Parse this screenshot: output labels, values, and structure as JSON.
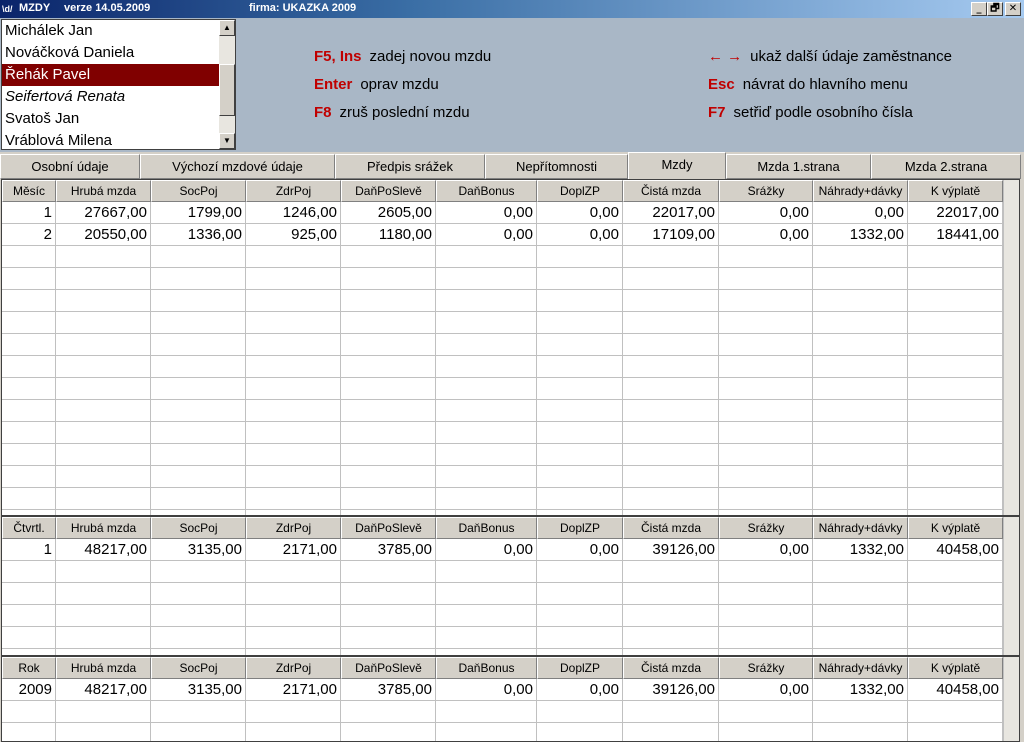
{
  "window": {
    "app_title": "MZDY",
    "version": "verze 14.05.2009",
    "firm": "firma: UKAZKA 2009",
    "icon_text": "\\d/",
    "min_glyph": "_",
    "max_glyph": "🗗",
    "close_glyph": "✕"
  },
  "employees": [
    {
      "name": "Michálek Jan",
      "selected": false,
      "italic": false
    },
    {
      "name": "Nováčková Daniela",
      "selected": false,
      "italic": false
    },
    {
      "name": "Řehák Pavel",
      "selected": true,
      "italic": false
    },
    {
      "name": "Seifertová Renata",
      "selected": false,
      "italic": true
    },
    {
      "name": "Svatoš Jan",
      "selected": false,
      "italic": false
    },
    {
      "name": "Vráblová Milena",
      "selected": false,
      "italic": false
    }
  ],
  "help": {
    "new_key": "F5, Ins",
    "new_text": "zadej novou mzdu",
    "edit_key": "Enter",
    "edit_text": "oprav mzdu",
    "delete_key": "F8",
    "delete_text": "zruš poslední mzdu",
    "arrows_key": "← →",
    "arrows_text": "ukaž další údaje zaměstnance",
    "esc_key": "Esc",
    "esc_text": "návrat do hlavního menu",
    "sort_key": "F7",
    "sort_text": "setřiď podle osobního čísla"
  },
  "tabs": [
    {
      "label": "Osobní údaje",
      "active": false
    },
    {
      "label": "Výchozí mzdové údaje",
      "active": false
    },
    {
      "label": "Předpis srážek",
      "active": false
    },
    {
      "label": "Nepřítomnosti",
      "active": false
    },
    {
      "label": "Mzdy",
      "active": true
    },
    {
      "label": "Mzda 1.strana",
      "active": false
    },
    {
      "label": "Mzda 2.strana",
      "active": false
    }
  ],
  "columns": [
    "Hrubá mzda",
    "SocPoj",
    "ZdrPoj",
    "DaňPoSlevě",
    "DaňBonus",
    "DoplZP",
    "Čistá mzda",
    "Srážky",
    "Náhrady+dávky",
    "K výplatě"
  ],
  "monthly": {
    "first_header": "Měsíc",
    "rows": [
      [
        "1",
        "27667,00",
        "1799,00",
        "1246,00",
        "2605,00",
        "0,00",
        "0,00",
        "22017,00",
        "0,00",
        "0,00",
        "22017,00"
      ],
      [
        "2",
        "20550,00",
        "1336,00",
        "925,00",
        "1180,00",
        "0,00",
        "0,00",
        "17109,00",
        "0,00",
        "1332,00",
        "18441,00"
      ]
    ]
  },
  "quarterly": {
    "first_header": "Čtvrtl.",
    "rows": [
      [
        "1",
        "48217,00",
        "3135,00",
        "2171,00",
        "3785,00",
        "0,00",
        "0,00",
        "39126,00",
        "0,00",
        "1332,00",
        "40458,00"
      ]
    ]
  },
  "yearly": {
    "first_header": "Rok",
    "rows": [
      [
        "2009",
        "48217,00",
        "3135,00",
        "2171,00",
        "3785,00",
        "0,00",
        "0,00",
        "39126,00",
        "0,00",
        "1332,00",
        "40458,00"
      ]
    ]
  },
  "colors": {
    "selected_bg": "#800000",
    "hotkey": "#c00000",
    "panel_bg": "#a9b7c6"
  }
}
